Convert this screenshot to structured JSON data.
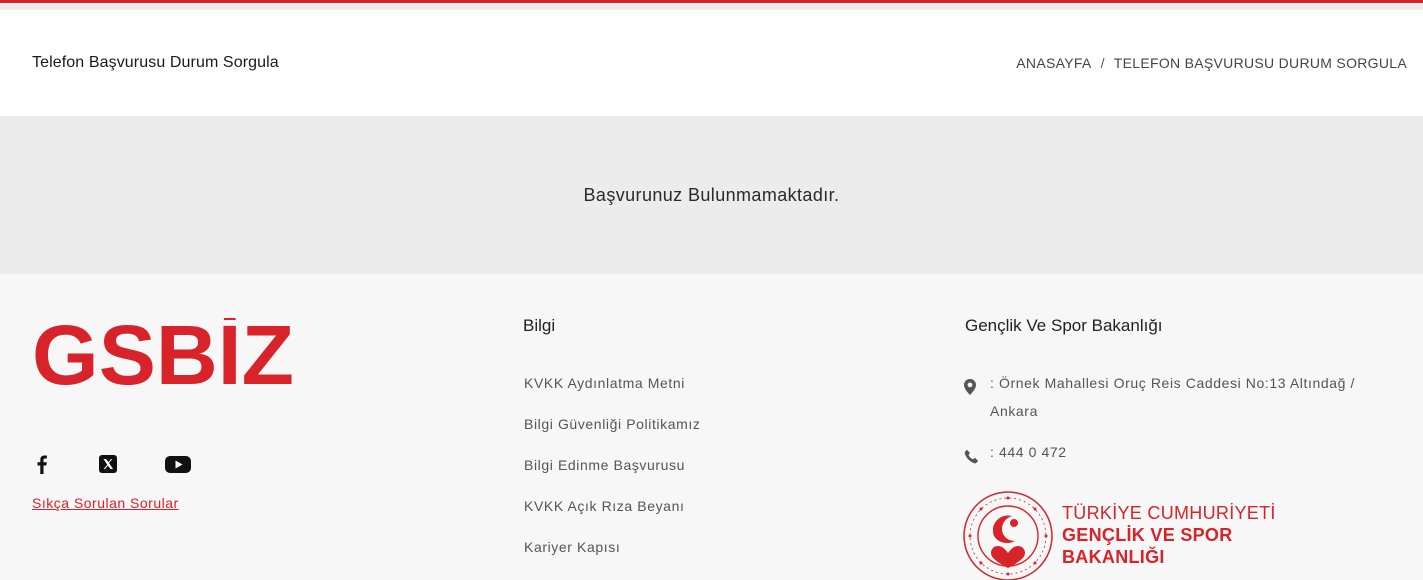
{
  "header": {
    "page_title": "Telefon Başvurusu Durum Sorgula",
    "breadcrumb": {
      "home": "ANASAYFA",
      "separator": "/",
      "current": "TELEFON BAŞVURUSU DURUM SORGULA"
    }
  },
  "result": {
    "message": "Başvurunuz Bulunmamaktadır."
  },
  "footer": {
    "logo_text": "GSBİZ",
    "social": [
      "facebook-icon",
      "x-icon",
      "youtube-icon"
    ],
    "faq_link": "Sıkça Sorulan Sorular",
    "bilgi": {
      "title": "Bilgi",
      "items": [
        "KVKK Aydınlatma Metni",
        "Bilgi Güvenliği Politikamız",
        "Bilgi Edinme Başvurusu",
        "KVKK Açık Rıza Beyanı",
        "Kariyer Kapısı"
      ]
    },
    "contact": {
      "title": "Gençlik Ve Spor Bakanlığı",
      "address": ": Örnek Mahallesi Oruç Reis Caddesi No:13 Altındağ / Ankara",
      "phone": ": 444 0 472"
    },
    "ministry": {
      "line1": "TÜRKİYE CUMHURİYETİ",
      "line2": "GENÇLİK VE SPOR",
      "line3": "BAKANLIĞI"
    }
  },
  "colors": {
    "brand_red": "#d8232a",
    "band_gray": "#ececec",
    "footer_bg": "#f7f7f7"
  }
}
